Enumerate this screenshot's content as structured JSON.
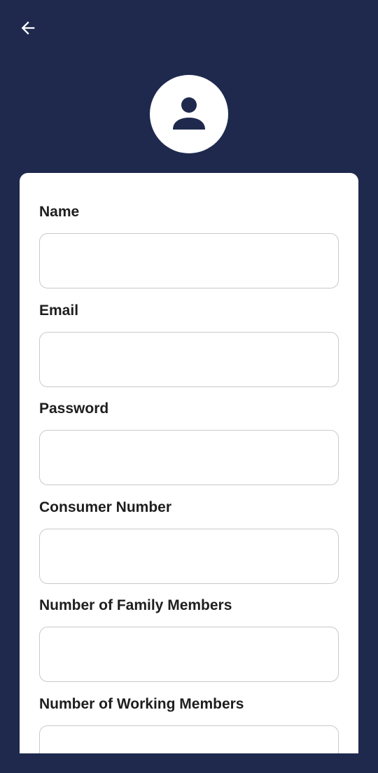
{
  "header": {
    "back_icon": "arrow-left-icon",
    "avatar_icon": "person-icon"
  },
  "colors": {
    "background": "#1e294d",
    "card": "#ffffff",
    "input_border": "#c9c9c9",
    "label": "#1e1e1e"
  },
  "form": {
    "fields": [
      {
        "label": "Name",
        "value": "",
        "placeholder": ""
      },
      {
        "label": "Email",
        "value": "",
        "placeholder": ""
      },
      {
        "label": "Password",
        "value": "",
        "placeholder": ""
      },
      {
        "label": "Consumer Number",
        "value": "",
        "placeholder": ""
      },
      {
        "label": "Number of Family Members",
        "value": "",
        "placeholder": ""
      },
      {
        "label": "Number of Working Members",
        "value": "",
        "placeholder": ""
      }
    ]
  }
}
